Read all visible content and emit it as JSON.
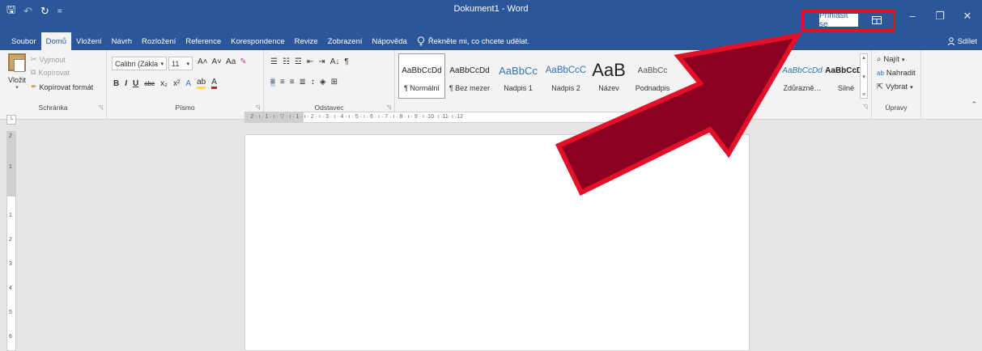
{
  "window": {
    "title": "Dokument1 - Word",
    "signin_label": "Přihlásit se",
    "minimize_glyph": "–",
    "restore_glyph": "❐",
    "close_glyph": "✕"
  },
  "qat": {
    "save_glyph": "🖫",
    "undo_glyph": "↶",
    "redo_glyph": "↻",
    "customize_glyph": "="
  },
  "tabs": [
    "Soubor",
    "Domů",
    "Vložení",
    "Návrh",
    "Rozložení",
    "Reference",
    "Korespondence",
    "Revize",
    "Zobrazení",
    "Nápověda"
  ],
  "active_tab": "Domů",
  "tell_me": "Řekněte mi, co chcete udělat.",
  "share_label": "Sdílet",
  "clipboard": {
    "paste_label": "Vložit",
    "cut_label": "Vyjmout",
    "copy_label": "Kopírovat",
    "format_painter_label": "Kopírovat formát",
    "group_label": "Schránka"
  },
  "font": {
    "font_name": "Calibri (Zákla",
    "font_size": "11",
    "grow_glyph": "A˄",
    "shrink_glyph": "A˅",
    "case_glyph": "Aa",
    "bold": "B",
    "italic": "I",
    "underline": "U",
    "strike": "abc",
    "subscript": "x₂",
    "superscript": "x²",
    "group_label": "Písmo"
  },
  "paragraph": {
    "group_label": "Odstavec",
    "pilcrow": "¶",
    "sort_glyph": "A↓"
  },
  "styles": {
    "items": [
      {
        "preview": "AaBbCcDd",
        "name": "¶ Normální"
      },
      {
        "preview": "AaBbCcDd",
        "name": "¶ Bez mezer"
      },
      {
        "preview": "AaBbCc",
        "name": "Nadpis 1"
      },
      {
        "preview": "AaBbCcC",
        "name": "Nadpis 2"
      },
      {
        "preview": "AaB",
        "name": "Název"
      },
      {
        "preview": "AaBbCc",
        "name": "Podnadpis"
      },
      {
        "preview": "AaBbCcDd",
        "name": "Zdůrazně…"
      },
      {
        "preview": "AaBbCcDc",
        "name": "Silné"
      }
    ]
  },
  "editing": {
    "find_label": "Najít",
    "replace_label": "Nahradit",
    "select_label": "Vybrat",
    "group_label": "Úpravy"
  },
  "ruler": {
    "text": "· 2 · ı · 1 · ı · ▽ · ı · 1 · ı · 2 · ı · 3 · ı · 4 · ı · 5 · ı · 6 · ı · 7 · ı · 8 · ı · 9 · ı ·10· ı ·11· ı ·12",
    "vertical_numbers": [
      "2",
      "1",
      "1",
      "2",
      "3",
      "4",
      "5",
      "6"
    ]
  },
  "colors": {
    "title_bar": "#2b579a",
    "ribbon": "#f3f3f3",
    "highlight": "#e3102a",
    "arrow_fill": "#8b0020"
  }
}
